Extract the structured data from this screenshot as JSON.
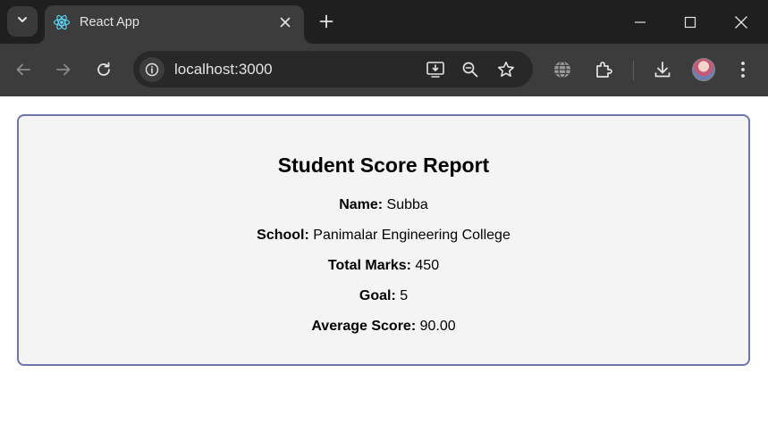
{
  "browser": {
    "tab_title": "React App",
    "url": "localhost:3000",
    "icons": [
      "tab-search-icon",
      "react-favicon-icon",
      "close-icon",
      "plus-icon",
      "minimize-icon",
      "maximize-icon",
      "window-close-icon",
      "back-arrow-icon",
      "forward-arrow-icon",
      "reload-icon",
      "info-icon",
      "install-app-icon",
      "zoom-out-icon",
      "star-icon",
      "translate-icon",
      "extensions-icon",
      "download-icon",
      "avatar",
      "more-vert-icon"
    ]
  },
  "report": {
    "title": "Student Score Report",
    "fields": [
      {
        "label": "Name:",
        "value": "Subba"
      },
      {
        "label": "School:",
        "value": "Panimalar Engineering College"
      },
      {
        "label": "Total Marks:",
        "value": "450"
      },
      {
        "label": "Goal:",
        "value": "5"
      },
      {
        "label": "Average Score:",
        "value": "90.00"
      }
    ]
  },
  "colors": {
    "card_border": "#6d75a6",
    "card_background": "#f4f4f4",
    "tabstrip": "#1f1f1f",
    "toolbar": "#3c3c3c"
  }
}
